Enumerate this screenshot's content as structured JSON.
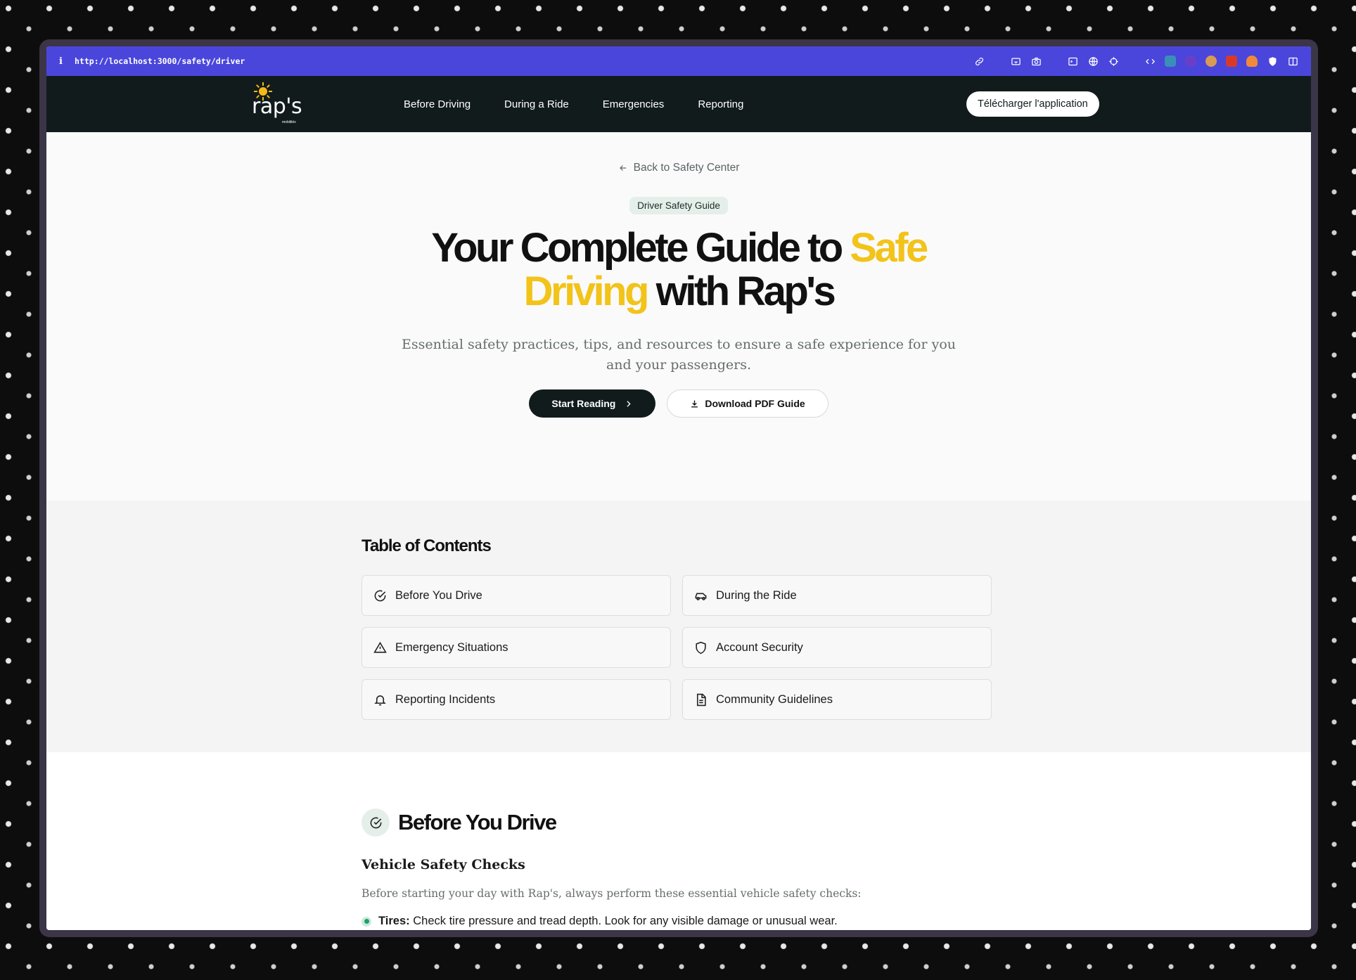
{
  "browser": {
    "info_glyph": "i",
    "url": "http://localhost:3000/safety/driver",
    "toolbar_icons": [
      "link-icon",
      "screenshot-icon",
      "camera-icon",
      "terminal-icon",
      "globe-icon",
      "target-icon",
      "code-icon",
      "extension-icon",
      "extension-icon",
      "extension-icon",
      "extension-icon",
      "extension-icon",
      "shield-icon",
      "sidebar-icon"
    ]
  },
  "nav": {
    "logo_text": "rap's",
    "logo_sub": "mobilités",
    "links": [
      "Before Driving",
      "During a Ride",
      "Emergencies",
      "Reporting"
    ],
    "cta": "Télécharger l'application"
  },
  "hero": {
    "back_link": "Back to Safety Center",
    "badge": "Driver Safety Guide",
    "title_part1": "Your Complete Guide to ",
    "title_highlight1": "Safe",
    "title_highlight2": "Driving",
    "title_part2": " with Rap's",
    "subtitle": "Essential safety practices, tips, and resources to ensure a safe experience for you and your passengers.",
    "primary_button": "Start Reading",
    "secondary_button": "Download PDF Guide"
  },
  "toc": {
    "title": "Table of Contents",
    "items": [
      {
        "label": "Before You Drive",
        "icon": "check-circle-icon"
      },
      {
        "label": "During the Ride",
        "icon": "car-icon"
      },
      {
        "label": "Emergency Situations",
        "icon": "warning-triangle-icon"
      },
      {
        "label": "Account Security",
        "icon": "shield-icon"
      },
      {
        "label": "Reporting Incidents",
        "icon": "bell-icon"
      },
      {
        "label": "Community Guidelines",
        "icon": "document-icon"
      }
    ]
  },
  "section": {
    "title": "Before You Drive",
    "subtitle": "Vehicle Safety Checks",
    "intro": "Before starting your day with Rap's, always perform these essential vehicle safety checks:",
    "bullet_label": "Tires:",
    "bullet_text": " Check tire pressure and tread depth. Look for any visible damage or unusual wear."
  },
  "colors": {
    "browser_bar": "#4a46dc",
    "nav_bg": "#111b1c",
    "accent_yellow": "#f2c319",
    "pill_bg": "#e4efea",
    "bullet_green": "#1ba26b"
  }
}
